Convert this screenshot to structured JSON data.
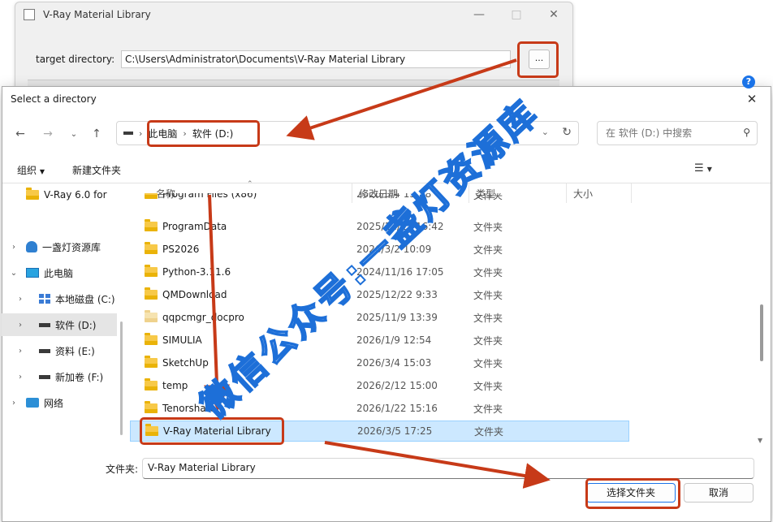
{
  "bg_window": {
    "title": "V-Ray Material Library",
    "target_label": "target directory:",
    "target_value": "C:\\Users\\Administrator\\Documents\\V-Ray Material Library",
    "browse_label": "..."
  },
  "dialog": {
    "title": "Select a directory",
    "address": {
      "crumbs": [
        "此电脑",
        "软件 (D:)"
      ]
    },
    "search_placeholder": "在 软件 (D:) 中搜索",
    "toolbar": {
      "organize": "组织",
      "new_folder": "新建文件夹"
    },
    "nav": [
      {
        "label": "V-Ray 6.0  for",
        "icon": "folder-icon"
      },
      {
        "label": "一盏灯资源库",
        "icon": "user-folder-icon"
      },
      {
        "label": "此电脑",
        "icon": "pc-icon"
      },
      {
        "label": "本地磁盘 (C:)",
        "icon": "windows-drive-icon"
      },
      {
        "label": "软件 (D:)",
        "icon": "drive-icon"
      },
      {
        "label": "资料 (E:)",
        "icon": "drive-icon"
      },
      {
        "label": "新加卷 (F:)",
        "icon": "drive-icon"
      },
      {
        "label": "网络",
        "icon": "network-icon"
      }
    ],
    "columns": {
      "name": "名称",
      "date": "修改日期",
      "type": "类型",
      "size": "大小"
    },
    "files": [
      {
        "name": "Program Files (x86)",
        "date": "2026/3/4 15:58",
        "type": "文件夹"
      },
      {
        "name": "ProgramData",
        "date": "2025/12/23 16:42",
        "type": "文件夹"
      },
      {
        "name": "PS2026",
        "date": "2026/3/2 10:09",
        "type": "文件夹"
      },
      {
        "name": "Python-3.11.6",
        "date": "2024/11/16 17:05",
        "type": "文件夹"
      },
      {
        "name": "QMDownload",
        "date": "2025/12/22 9:33",
        "type": "文件夹"
      },
      {
        "name": "qqpcmgr_docpro",
        "date": "2025/11/9 13:39",
        "type": "文件夹"
      },
      {
        "name": "SIMULIA",
        "date": "2026/1/9 12:54",
        "type": "文件夹"
      },
      {
        "name": "SketchUp",
        "date": "2026/3/4 15:03",
        "type": "文件夹"
      },
      {
        "name": "temp",
        "date": "2026/2/12 15:00",
        "type": "文件夹"
      },
      {
        "name": "Tenorshare",
        "date": "2026/1/22 15:16",
        "type": "文件夹"
      },
      {
        "name": "V-Ray Material Library",
        "date": "2026/3/5 17:25",
        "type": "文件夹"
      }
    ],
    "folder_label": "文件夹:",
    "folder_value": "V-Ray Material Library",
    "ok_label": "选择文件夹",
    "cancel_label": "取消"
  },
  "watermark": "微信公众号:一盏灯资源库",
  "colors": {
    "highlight": "#c73a18",
    "selection": "#cce8ff",
    "folder": "#f7c948",
    "accent": "#1a73e8"
  }
}
